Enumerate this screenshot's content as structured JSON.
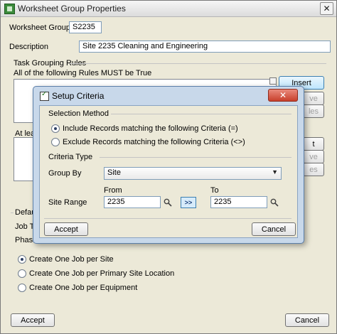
{
  "window": {
    "title": "Worksheet Group Properties",
    "close_glyph": "✕"
  },
  "main": {
    "worksheet_group_label": "Worksheet Group",
    "worksheet_group_value": "S2235",
    "description_label": "Description",
    "description_value": "Site 2235 Cleaning and Engineering",
    "task_grouping_title": "Task Grouping Rules",
    "must_rules_label": "All of the following Rules MUST be True",
    "insert_label": "Insert",
    "partial_remove_label": "ve",
    "partial_rules_label": "les",
    "partial_at_least_label": "At leas",
    "partial_edit_label": "t",
    "partial_remove2_label": "ve",
    "partial_rules2_label": "es",
    "partial_defaults_label": "Defaul",
    "partial_job_type_label": "Job Ty",
    "partial_phase_label": "Phase",
    "radio_options": [
      {
        "label": "Create One Job per Site",
        "selected": true
      },
      {
        "label": "Create One Job per Primary Site Location",
        "selected": false
      },
      {
        "label": "Create One Job per Equipment",
        "selected": false
      }
    ],
    "accept_label": "Accept",
    "cancel_label": "Cancel"
  },
  "dialog": {
    "title": "Setup Criteria",
    "close_glyph": "✕",
    "selection_method_title": "Selection Method",
    "selection_options": [
      {
        "label": "Include Records matching the following Criteria (=)",
        "selected": true
      },
      {
        "label": "Exclude Records matching the following Criteria (<>)",
        "selected": false
      }
    ],
    "criteria_type_title": "Criteria Type",
    "group_by_label": "Group By",
    "group_by_value": "Site",
    "from_label": "From",
    "to_label": "To",
    "site_range_label": "Site Range",
    "from_value": "2235",
    "to_value": "2235",
    "range_button_label": ">>",
    "accept_label": "Accept",
    "cancel_label": "Cancel"
  }
}
